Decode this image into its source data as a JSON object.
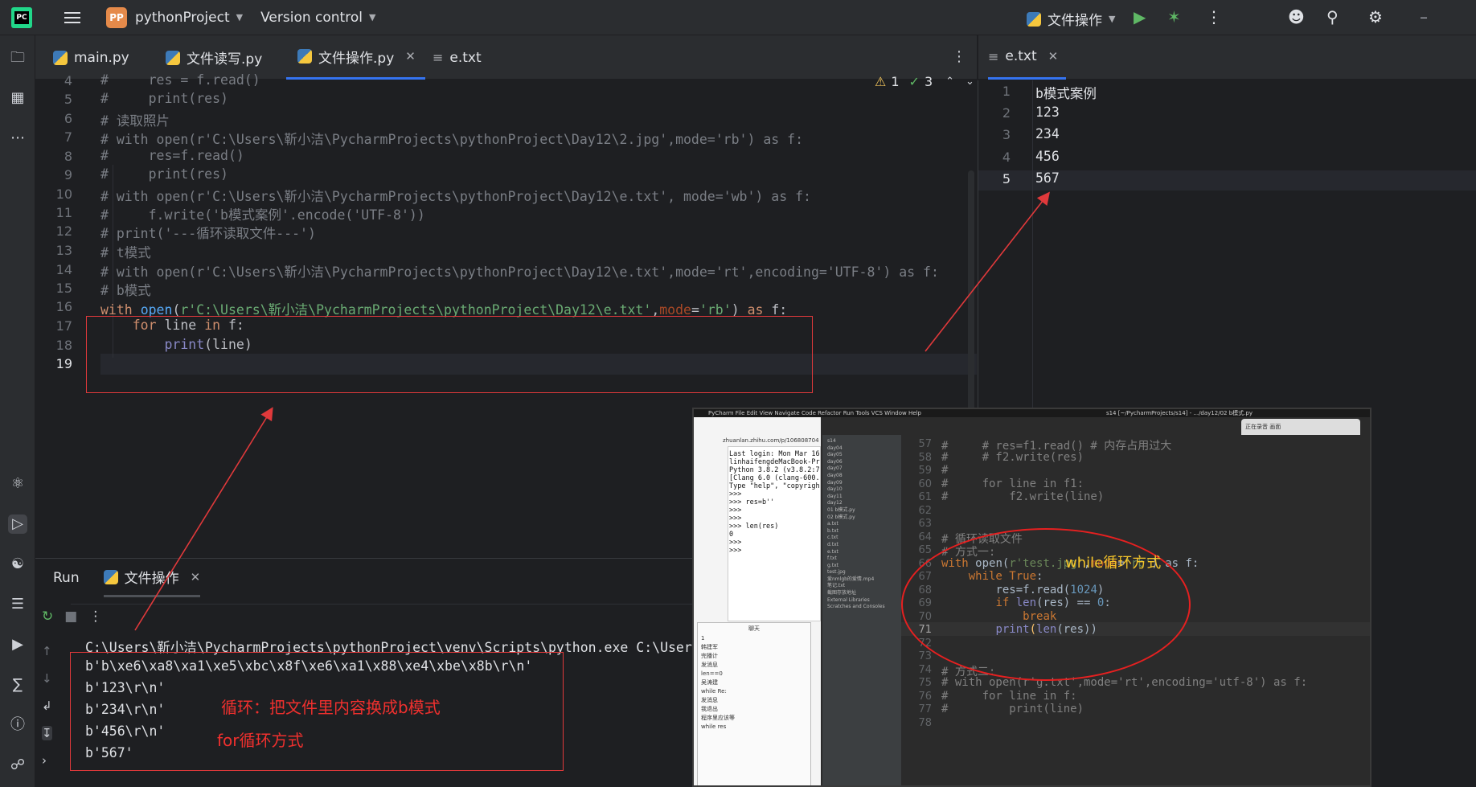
{
  "titlebar": {
    "project_initials": "PP",
    "project_name": "pythonProject",
    "vcs_label": "Version control",
    "run_config": "文件操作"
  },
  "editor_tabs": [
    {
      "label": "main.py",
      "type": "py"
    },
    {
      "label": "文件读写.py",
      "type": "py"
    },
    {
      "label": "文件操作.py",
      "type": "py",
      "active": true
    },
    {
      "label": "e.txt",
      "type": "txt"
    }
  ],
  "inspection": {
    "warnings": "1",
    "typos": "3"
  },
  "main_code": {
    "line_numbers": [
      "4",
      "5",
      "6",
      "7",
      "8",
      "9",
      "10",
      "11",
      "12",
      "13",
      "14",
      "15",
      "16",
      "17",
      "18",
      "19"
    ],
    "lines": [
      "#     res = f.read()",
      "#     print(res)",
      "# 读取照片",
      "# with open(r'C:\\Users\\靳小洁\\PycharmProjects\\pythonProject\\Day12\\2.jpg',mode='rb') as f:",
      "#     res=f.read()",
      "#     print(res)",
      "# with open(r'C:\\Users\\靳小洁\\PycharmProjects\\pythonProject\\Day12\\e.txt', mode='wb') as f:",
      "#     f.write('b模式案例'.encode('UTF-8'))",
      "# print('---循环读取文件---')",
      "# t模式",
      "# with open(r'C:\\Users\\靳小洁\\PycharmProjects\\pythonProject\\Day12\\e.txt',mode='rt',encoding='UTF-8') as f:",
      "# b模式"
    ],
    "l16_kw": "with",
    "l16_fn": "open",
    "l16_str": "r'C:\\Users\\靳小洁\\PycharmProjects\\pythonProject\\Day12\\e.txt'",
    "l16_prm": "mode",
    "l16_mode": "'rb'",
    "l16_as": "as",
    "l16_f": "f:",
    "l17_for": "for",
    "l17_line": "line",
    "l17_in": "in",
    "l17_f": "f:",
    "l18_print": "print",
    "l18_arg": "(line)"
  },
  "right_panel": {
    "tab": "e.txt",
    "line_numbers": [
      "1",
      "2",
      "3",
      "4",
      "5"
    ],
    "lines": [
      "b模式案例",
      "123",
      "234",
      "456",
      "567"
    ]
  },
  "run_panel": {
    "title": "Run",
    "tab": "文件操作",
    "command": "C:\\Users\\靳小洁\\PycharmProjects\\pythonProject\\venv\\Scripts\\python.exe C:\\User",
    "output": [
      "b'b\\xe6\\xa8\\xa1\\xe5\\xbc\\x8f\\xe6\\xa1\\x88\\xe4\\xbe\\x8b\\r\\n'",
      "b'123\\r\\n'",
      "b'234\\r\\n'",
      "b'456\\r\\n'",
      "b'567'"
    ]
  },
  "annotations": {
    "loop_note": "循环：把文件里内容换成b模式",
    "for_note": "for循环方式",
    "while_note": "while循环方式"
  },
  "screenshot": {
    "menubar": "PyCharm  File  Edit  View  Navigate  Code  Refactor  Run  Tools  VCS  Window  Help",
    "window_title": "s14 [~/PycharmProjects/s14] - .../day12/02 b模式.py",
    "notification": "正在录音 画面",
    "browser_url": "zhuanlan.zhihu.com/p/106808704",
    "terminal": [
      "Last login: Mon Mar 16",
      "linhaifengdeMacBook-Pro",
      "Python 3.8.2 (v3.8.2:7b",
      "[Clang 6.0 (clang-600.0",
      "Type \"help\", \"copyright",
      ">>>",
      ">>> res=b''",
      ">>>",
      ">>>",
      ">>> len(res)",
      "0",
      ">>>",
      ">>> "
    ],
    "tree": [
      "s14",
      "day04",
      "day05",
      "day06",
      "day07",
      "day08",
      "day09",
      "day10",
      "day11",
      "day12",
      "01 b模式.py",
      "02 b模式.py",
      "a.txt",
      "b.txt",
      "c.txt",
      "d.txt",
      "e.txt",
      "f.txt",
      "g.txt",
      "test.jpg",
      "爱nmlgb的爱情.mp4",
      "笔记.txt",
      "截图存放地址",
      "External Libraries",
      "Scratches and Consoles"
    ],
    "line_numbers": [
      "57",
      "58",
      "59",
      "60",
      "61",
      "62",
      "63",
      "64",
      "65",
      "66",
      "67",
      "68",
      "69",
      "70",
      "71",
      "72",
      "73",
      "74",
      "75",
      "76",
      "77",
      "78"
    ],
    "code": [
      "#     # res=f1.read() # 内存占用过大",
      "#     # f2.write(res)",
      "#",
      "#     for line in f1:",
      "#         f2.write(line)",
      "",
      "",
      "# 循环读取文件",
      "# 方式一:",
      "",
      "",
      "",
      "",
      "",
      "",
      "",
      "",
      "# 方式二:",
      "# with open(r'g.txt',mode='rt',encoding='utf-8') as f:",
      "#     for line in f:",
      "#         print(line)",
      ""
    ],
    "c66": [
      "with ",
      "open",
      "(",
      "r'test.jpg'",
      ",",
      "mode",
      "=",
      "'rb'",
      ") as f:"
    ],
    "c67": [
      "while ",
      "True",
      ":"
    ],
    "c68": [
      "res=f.read(",
      "1024",
      ")"
    ],
    "c69": [
      "if ",
      "len",
      "(res) == ",
      "0",
      ":"
    ],
    "c70": "break",
    "c71": [
      "print",
      "(",
      "len",
      "(res))"
    ],
    "dialog_title": "聊天",
    "dialog_items": [
      "1",
      "韩建军",
      "完播计",
      "发消息",
      "len==0",
      "吴涛建",
      "while Re:",
      "发消息",
      "我退出",
      "程序里应该等",
      "while res"
    ]
  }
}
